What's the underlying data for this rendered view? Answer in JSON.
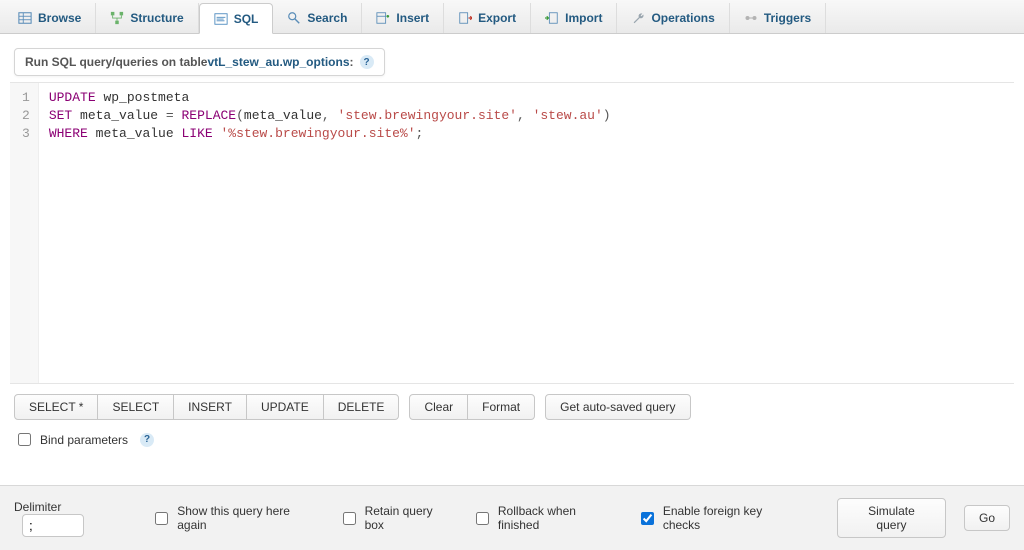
{
  "colors": {
    "link": "#235a81",
    "keyword": "#8b0074",
    "string": "#b94a48",
    "accent": "#0a72da"
  },
  "tabs": [
    {
      "label": "Browse",
      "icon": "table-icon",
      "active": false
    },
    {
      "label": "Structure",
      "icon": "structure-icon",
      "active": false
    },
    {
      "label": "SQL",
      "icon": "sql-icon",
      "active": true
    },
    {
      "label": "Search",
      "icon": "search-icon",
      "active": false
    },
    {
      "label": "Insert",
      "icon": "insert-icon",
      "active": false
    },
    {
      "label": "Export",
      "icon": "export-icon",
      "active": false
    },
    {
      "label": "Import",
      "icon": "import-icon",
      "active": false
    },
    {
      "label": "Operations",
      "icon": "wrench-icon",
      "active": false
    },
    {
      "label": "Triggers",
      "icon": "triggers-icon",
      "active": false
    }
  ],
  "legend": {
    "prefix": "Run SQL query/queries on table ",
    "tablename": "vtL_stew_au.wp_options",
    "suffix": ":"
  },
  "sql": {
    "lines": [
      "1",
      "2",
      "3"
    ],
    "line1": {
      "kw1": "UPDATE",
      "ident": "wp_postmeta"
    },
    "line2": {
      "kw1": "SET",
      "ident1": "meta_value",
      "eq": "=",
      "fn": "REPLACE",
      "open": "(",
      "arg1": "meta_value",
      "comma1": ", ",
      "str1": "'stew.brewingyour.site'",
      "comma2": ", ",
      "str2": "'stew.au'",
      "close": ")"
    },
    "line3": {
      "kw1": "WHERE",
      "ident": "meta_value",
      "kw2": "LIKE",
      "str": "'%stew.brewingyour.site%'",
      "semi": ";"
    }
  },
  "shortcut_buttons": {
    "select_star": "SELECT *",
    "select": "SELECT",
    "insert": "INSERT",
    "update": "UPDATE",
    "delete": "DELETE"
  },
  "action_buttons": {
    "clear": "Clear",
    "format": "Format",
    "autosave": "Get auto-saved query"
  },
  "bind_params": {
    "label": "Bind parameters"
  },
  "footer": {
    "delimiter_label": "Delimiter",
    "delimiter_value": ";",
    "show_again": "Show this query here again",
    "retain": "Retain query box",
    "rollback": "Rollback when finished",
    "fk": "Enable foreign key checks",
    "fk_checked": true,
    "simulate": "Simulate query",
    "go": "Go"
  }
}
